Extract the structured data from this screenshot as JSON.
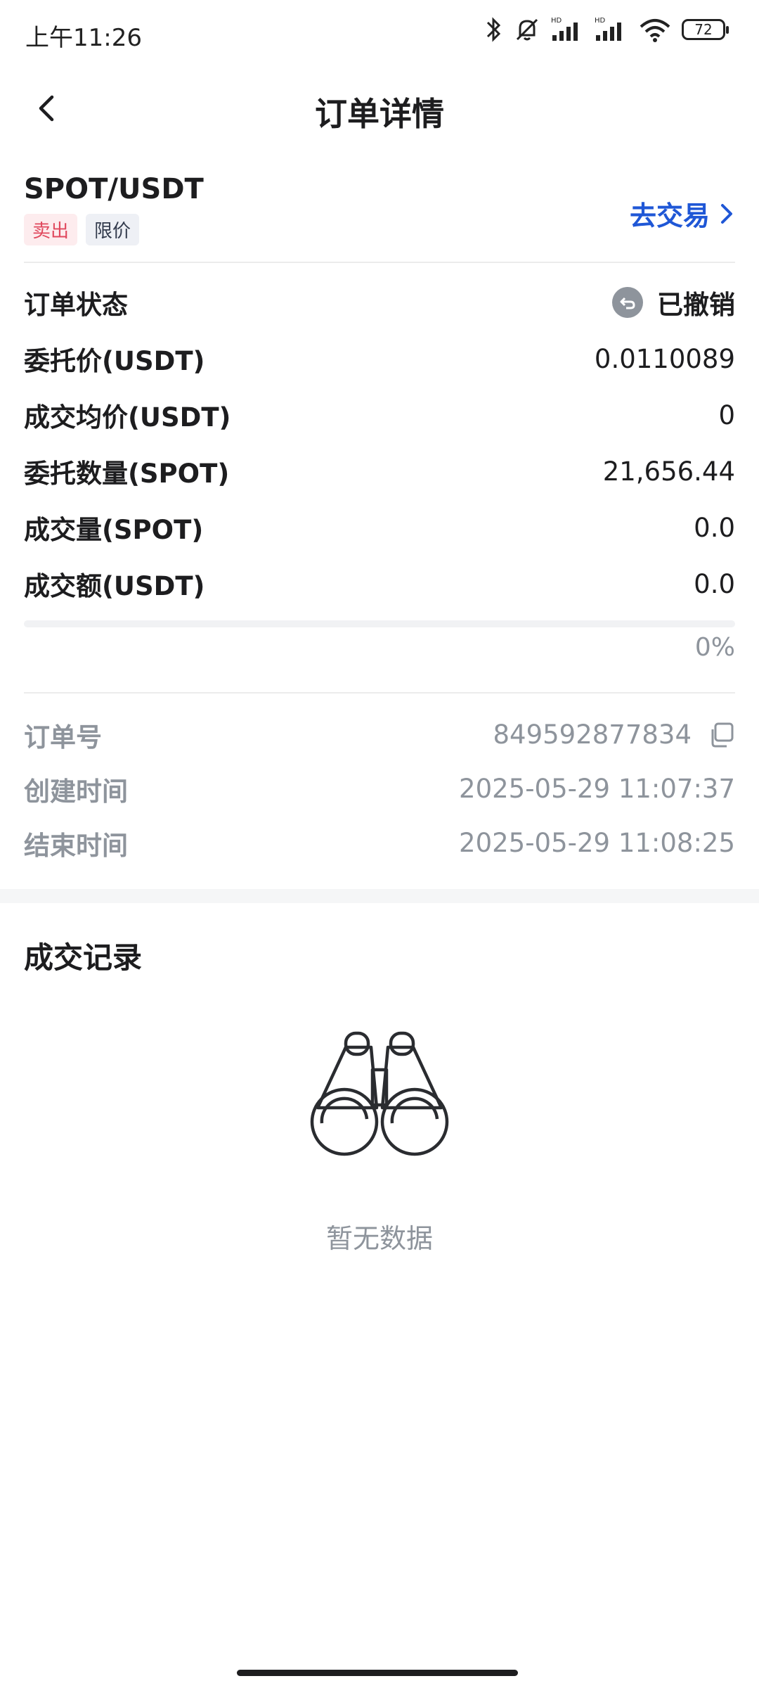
{
  "status_bar": {
    "time": "上午11:26",
    "battery": "72"
  },
  "nav": {
    "title": "订单详情"
  },
  "order": {
    "pair": "SPOT/USDT",
    "tags": {
      "side": "卖出",
      "type": "限价"
    },
    "trade_link": "去交易",
    "fill_progress_percent": 0
  },
  "rows": [
    {
      "label": "订单状态",
      "value": "已撤销"
    },
    {
      "label": "委托价(USDT)",
      "value": "0.0110089"
    },
    {
      "label": "成交均价(USDT)",
      "value": "0"
    },
    {
      "label": "委托数量(SPOT)",
      "value": "21,656.44"
    },
    {
      "label": "成交量(SPOT)",
      "value": "0.0"
    },
    {
      "label": "成交额(USDT)",
      "value": "0.0"
    }
  ],
  "progress_text": "0%",
  "meta": [
    {
      "label": "订单号",
      "value": "849592877834"
    },
    {
      "label": "创建时间",
      "value": "2025-05-29 11:07:37"
    },
    {
      "label": "结束时间",
      "value": "2025-05-29 11:08:25"
    }
  ],
  "trades": {
    "title": "成交记录",
    "empty_text": "暂无数据"
  },
  "colors": {
    "accent": "#1f57d6",
    "sell": "#e0485d",
    "muted": "#8e949c"
  }
}
